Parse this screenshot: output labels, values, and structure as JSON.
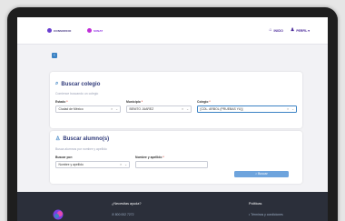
{
  "header": {
    "logo1_text": "CONSORCIO",
    "logo2_text": "SUNAT",
    "nav": [
      {
        "label": "INICIO",
        "icon": "home-icon"
      },
      {
        "label": "PERFIL ▾",
        "icon": "user-icon"
      }
    ]
  },
  "colegio": {
    "title": "Buscar colegio",
    "subtitle": "Comience buscando un colegio",
    "estado_label": "Estado",
    "estado_value": "Ciudad de México",
    "municipio_label": "Municipio",
    "municipio_value": "BENITO JUAREZ",
    "colegio_label": "Colegio",
    "colegio_value": "[COL. ARBOL (PRUEBAS YU)]",
    "req_mark": "*"
  },
  "alumno": {
    "title": "Buscar alumno(s)",
    "subtitle": "Busca alumnos por nombre y apellido",
    "buscar_por_label": "Buscar por:",
    "buscar_por_value": "Nombre y apellido",
    "nombre_label": "Nombre y apellido",
    "nombre_value": "",
    "search_button": "Buscar"
  },
  "footer": {
    "help_title": "¿Necesitas ayuda?",
    "phone": "800 002 7272",
    "policies_title": "Políticas",
    "policy_item": "• Términos y condiciones"
  },
  "colors": {
    "accent": "#3b82c4",
    "nav_purple": "#4b2a9a",
    "footer_bg": "#2b2f3a"
  }
}
